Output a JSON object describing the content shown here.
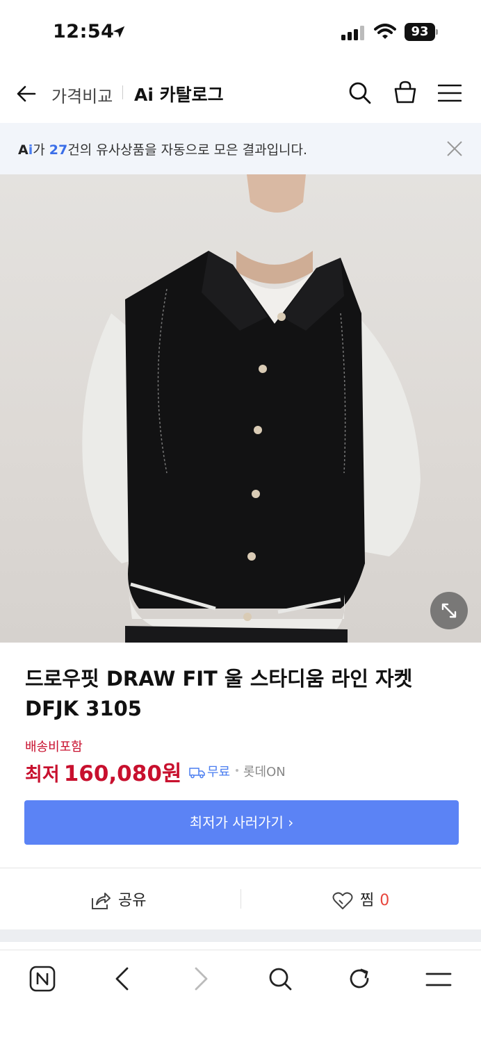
{
  "status_bar": {
    "time": "12:54",
    "battery": "93"
  },
  "header": {
    "breadcrumb_parent": "가격비교",
    "breadcrumb_current": "Ai 카탈로그"
  },
  "banner": {
    "ai_label_a": "A",
    "ai_label_i": "i",
    "prefix": "가 ",
    "count": "27",
    "suffix": "건의 유사상품을 자동으로 모은 결과입니다."
  },
  "product": {
    "title": "드로우핏 DRAW FIT 울 스타디움 라인 자켓 DFJK 3105",
    "shipping_included": "배송비포함",
    "price_label": "최저",
    "price": "160,080원",
    "shipping": "무료",
    "seller": "롯데ON",
    "cta": "최저가 사러가기 ›"
  },
  "actions": {
    "share": "공유",
    "favorite": "찜",
    "favorite_count": "0"
  },
  "colors": {
    "accent": "#5b83f5",
    "price": "#c8102e",
    "link": "#4a7df0"
  }
}
